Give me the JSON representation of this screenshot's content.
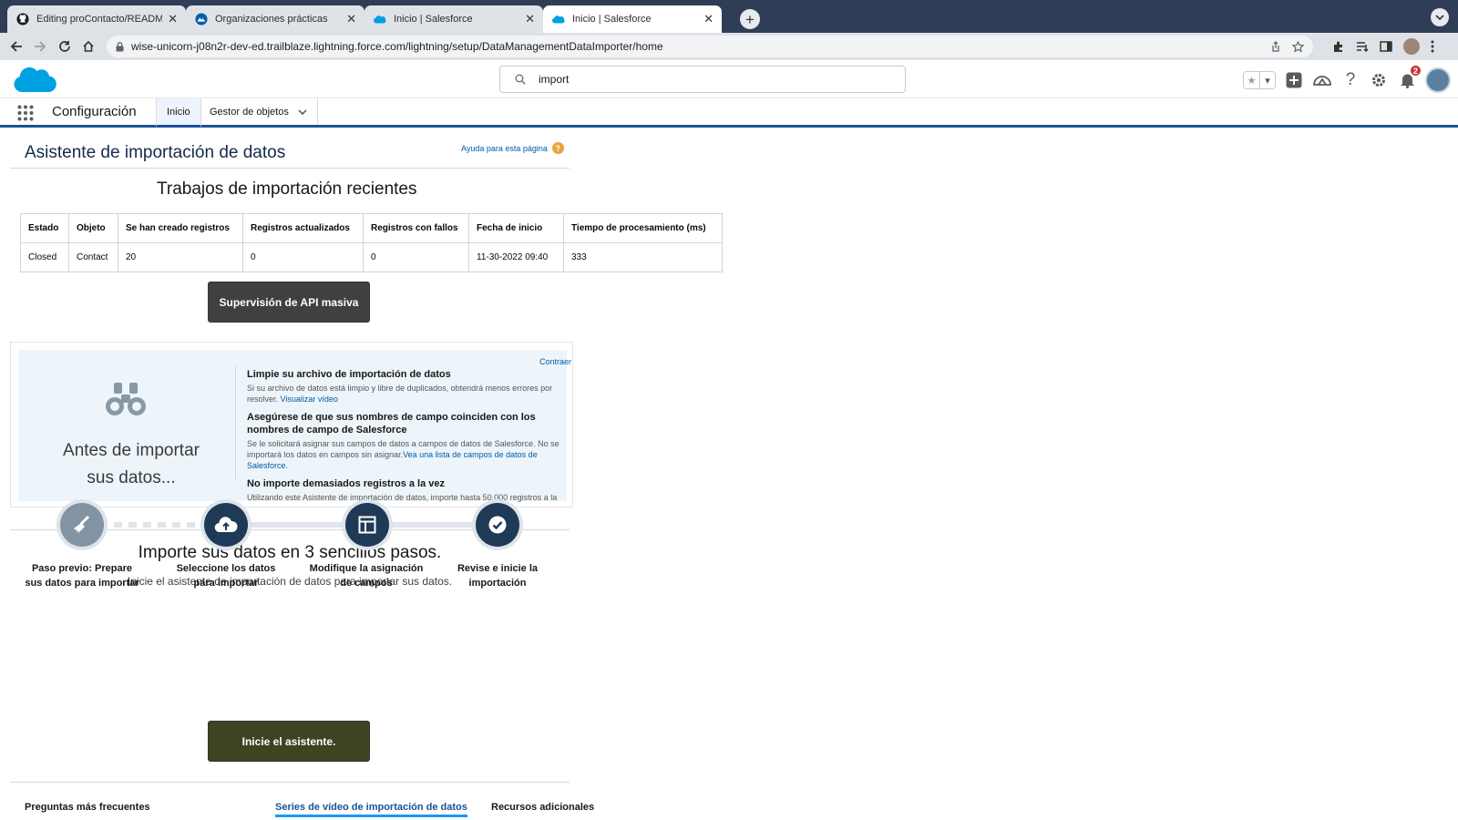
{
  "browser": {
    "tabs": [
      {
        "title": "Editing proContacto/README.r",
        "icon": "github-icon"
      },
      {
        "title": "Organizaciones prácticas",
        "icon": "trailhead-icon"
      },
      {
        "title": "Inicio | Salesforce",
        "icon": "salesforce-cloud-icon"
      },
      {
        "title": "Inicio | Salesforce",
        "icon": "salesforce-cloud-icon"
      }
    ],
    "close_glyph": "✕",
    "new_tab_glyph": "+",
    "url": "wise-unicorn-j08n2r-dev-ed.trailblaze.lightning.force.com/lightning/setup/DataManagementDataImporter/home"
  },
  "header": {
    "search_value": "import",
    "notification_count": "2",
    "help_glyph": "?"
  },
  "nav": {
    "app_name": "Configuración",
    "tabs": [
      "Inicio",
      "Gestor de objetos"
    ]
  },
  "page": {
    "title": "Asistente de importación de datos",
    "help_link": "Ayuda para esta página",
    "help_glyph": "?"
  },
  "recent_jobs": {
    "title": "Trabajos de importación recientes",
    "columns": [
      "Estado",
      "Objeto",
      "Se han creado registros",
      "Registros actualizados",
      "Registros con fallos",
      "Fecha de inicio",
      "Tiempo de procesamiento (ms)"
    ],
    "rows": [
      [
        "Closed",
        "Contact",
        "20",
        "0",
        "0",
        "11-30-2022 09:40",
        "333"
      ]
    ],
    "bulk_button": "Supervisión de API masiva"
  },
  "before_import": {
    "title_line1": "Antes de importar",
    "title_line2": "sus datos...",
    "collapse_link": "Contraer",
    "tips": [
      {
        "heading": "Limpie su archivo de importación de datos",
        "body": "Si su archivo de datos está limpio y libre de duplicados, obtendrá menos errores por resolver.",
        "link": "Visualizar vídeo"
      },
      {
        "heading": "Asegúrese de que sus nombres de campo coinciden con los nombres de campo de Salesforce",
        "body": "Se le solicitará asignar sus campos de datos a campos de datos de Salesforce. No se importará los datos en campos sin asignar.",
        "link": "Vea una lista de campos de datos de Salesforce."
      },
      {
        "heading": "No importe demasiados registros a la vez",
        "body": "Utilizando este Asistente de importación de datos, importe hasta 50.000 registros a la vez. La importación de demasiados registros puede ralentizar su",
        "link": ""
      }
    ]
  },
  "steps": {
    "title": "Importe sus datos en 3 sencillos pasos.",
    "subtitle": "Inicie el asistente de importación de datos para importar sus datos.",
    "items": [
      {
        "label": "Paso previo: Prepare sus datos para importar",
        "icon": "broom-icon",
        "color": "#8293a4"
      },
      {
        "label": "Seleccione los datos para importar",
        "icon": "cloud-upload-icon",
        "color": "#1e3a56"
      },
      {
        "label": "Modifique la asignación de campos",
        "icon": "layout-icon",
        "color": "#1e3a56"
      },
      {
        "label": "Revise e inicie la importación",
        "icon": "check-icon",
        "color": "#1e3a56"
      }
    ],
    "start_button": "Inicie el asistente."
  },
  "bottom_tabs": {
    "faq": "Preguntas más frecuentes",
    "videos": "Series de vídeo de importación de datos",
    "resources": "Recursos adicionales"
  },
  "colors": {
    "chrome_dark": "#2f3e56",
    "brand_blue": "#1b5297",
    "salesforce_cloud": "#00a1e0",
    "bulk_button": "#404040",
    "start_button": "#3d4422"
  }
}
